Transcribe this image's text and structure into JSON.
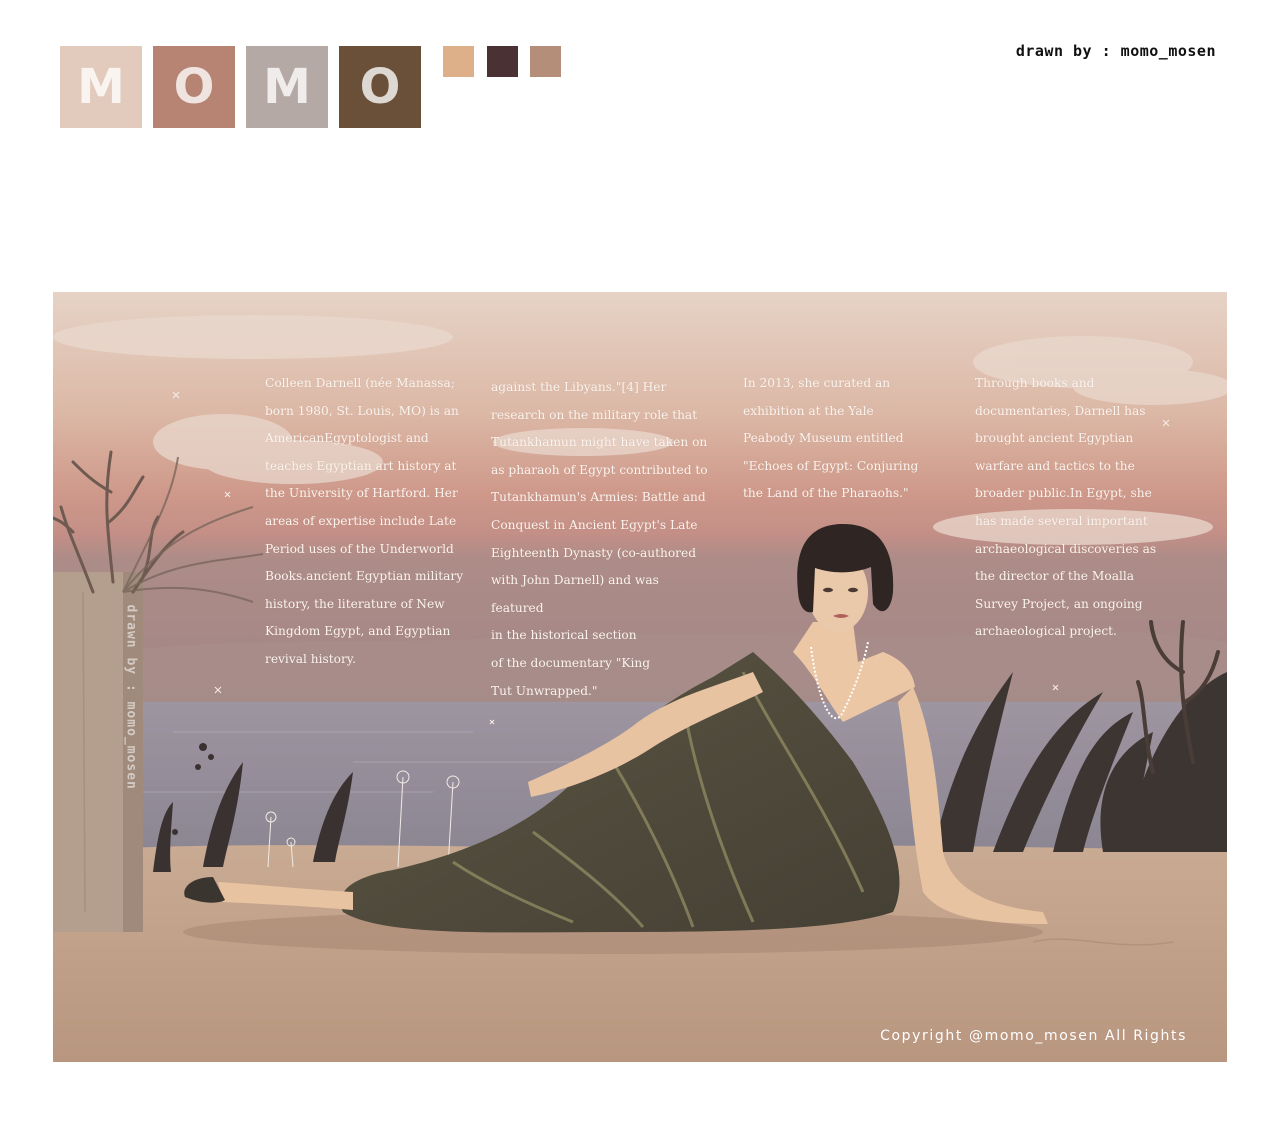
{
  "header": {
    "letters": [
      {
        "char": "M",
        "color": "#e2cbbc"
      },
      {
        "char": "O",
        "color": "#b78473"
      },
      {
        "char": "M",
        "color": "#b5a9a5"
      },
      {
        "char": "O",
        "color": "#6a5038"
      }
    ],
    "palette": [
      "#deb08a",
      "#4a3234",
      "#b48e78"
    ],
    "credit": "drawn by : momo_mosen"
  },
  "artwork": {
    "columns": [
      "Colleen Darnell (née Manassa;\nborn 1980, St. Louis, MO) is an\nAmericanEgyptologist and\nteaches Egyptian art history at\nthe University of Hartford. Her\nareas of expertise include Late\nPeriod uses of the Underworld\nBooks.ancient Egyptian military\nhistory, the literature of New\nKingdom Egypt, and Egyptian\nrevival history.",
      " against the Libyans.\"[4] Her\nresearch on the military role that\nTutankhamun might have taken on\nas pharaoh of Egypt contributed to\nTutankhamun's Armies: Battle and\nConquest in Ancient Egypt's Late\nEighteenth Dynasty (co-authored\nwith John Darnell) and was featured\nin the historical section\nof the documentary \"King\nTut Unwrapped.\"",
      "In 2013, she curated an\nexhibition at the Yale\nPeabody Museum entitled\n\"Echoes of Egypt: Conjuring\nthe Land of the Pharaohs.\"",
      "Through books and\ndocumentaries, Darnell has\nbrought ancient Egyptian\nwarfare and tactics to the\nbroader public.In Egypt, she\nhas made several important\narchaeological discoveries as\nthe director of the Moalla\nSurvey Project, an ongoing\narchaeological project."
    ],
    "side_credit": "drawn by : momo_mosen",
    "copyright": "Copyright @momo_mosen All Rights"
  }
}
